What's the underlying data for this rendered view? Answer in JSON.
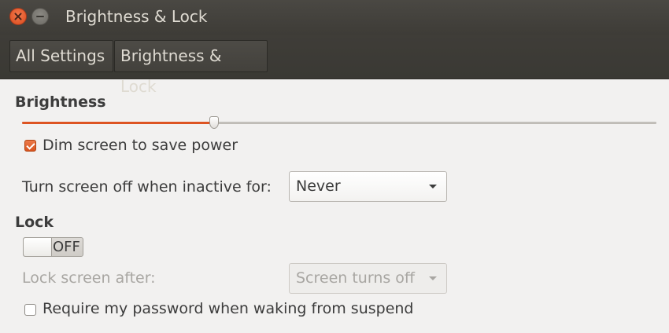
{
  "window": {
    "title": "Brightness & Lock"
  },
  "breadcrumb": {
    "items": [
      "All Settings",
      "Brightness & Lock"
    ]
  },
  "brightness": {
    "section_title": "Brightness",
    "slider_level": 0.303,
    "dim_label": "Dim screen to save power",
    "dim_checked": true,
    "turn_off_label": "Turn screen off when inactive for:",
    "turn_off_value": "Never"
  },
  "lock": {
    "section_title": "Lock",
    "switch_label": "OFF",
    "switch_on": false,
    "lock_after_label": "Lock screen after:",
    "lock_after_value": "Screen turns off",
    "require_password_label": "Require my password when waking from suspend",
    "require_password_checked": false
  },
  "colors": {
    "accent": "#dd5422",
    "titlebar": "#3f3d38",
    "background": "#f2f1f0"
  }
}
